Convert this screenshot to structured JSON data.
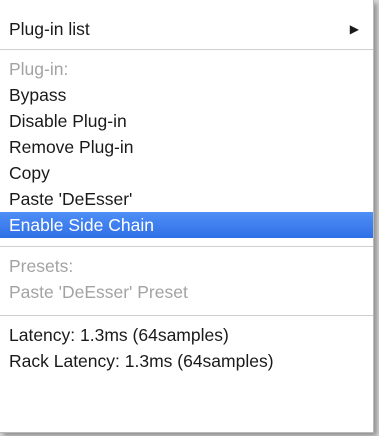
{
  "menu": {
    "submenu": {
      "label": "Plug-in list",
      "arrow": "▶"
    },
    "plugin_section": {
      "header": "Plug-in:",
      "items": [
        "Bypass",
        "Disable Plug-in",
        "Remove Plug-in",
        "Copy",
        "Paste 'DeEsser'"
      ],
      "selected": "Enable Side Chain"
    },
    "presets_section": {
      "header": "Presets:",
      "paste_preset": "Paste 'DeEsser' Preset"
    },
    "latency": "Latency: 1.3ms (64samples)",
    "rack_latency": "Rack Latency: 1.3ms (64samples)"
  },
  "colors": {
    "selection": "#3d7ff0",
    "disabled_text": "#a3a3a3"
  }
}
